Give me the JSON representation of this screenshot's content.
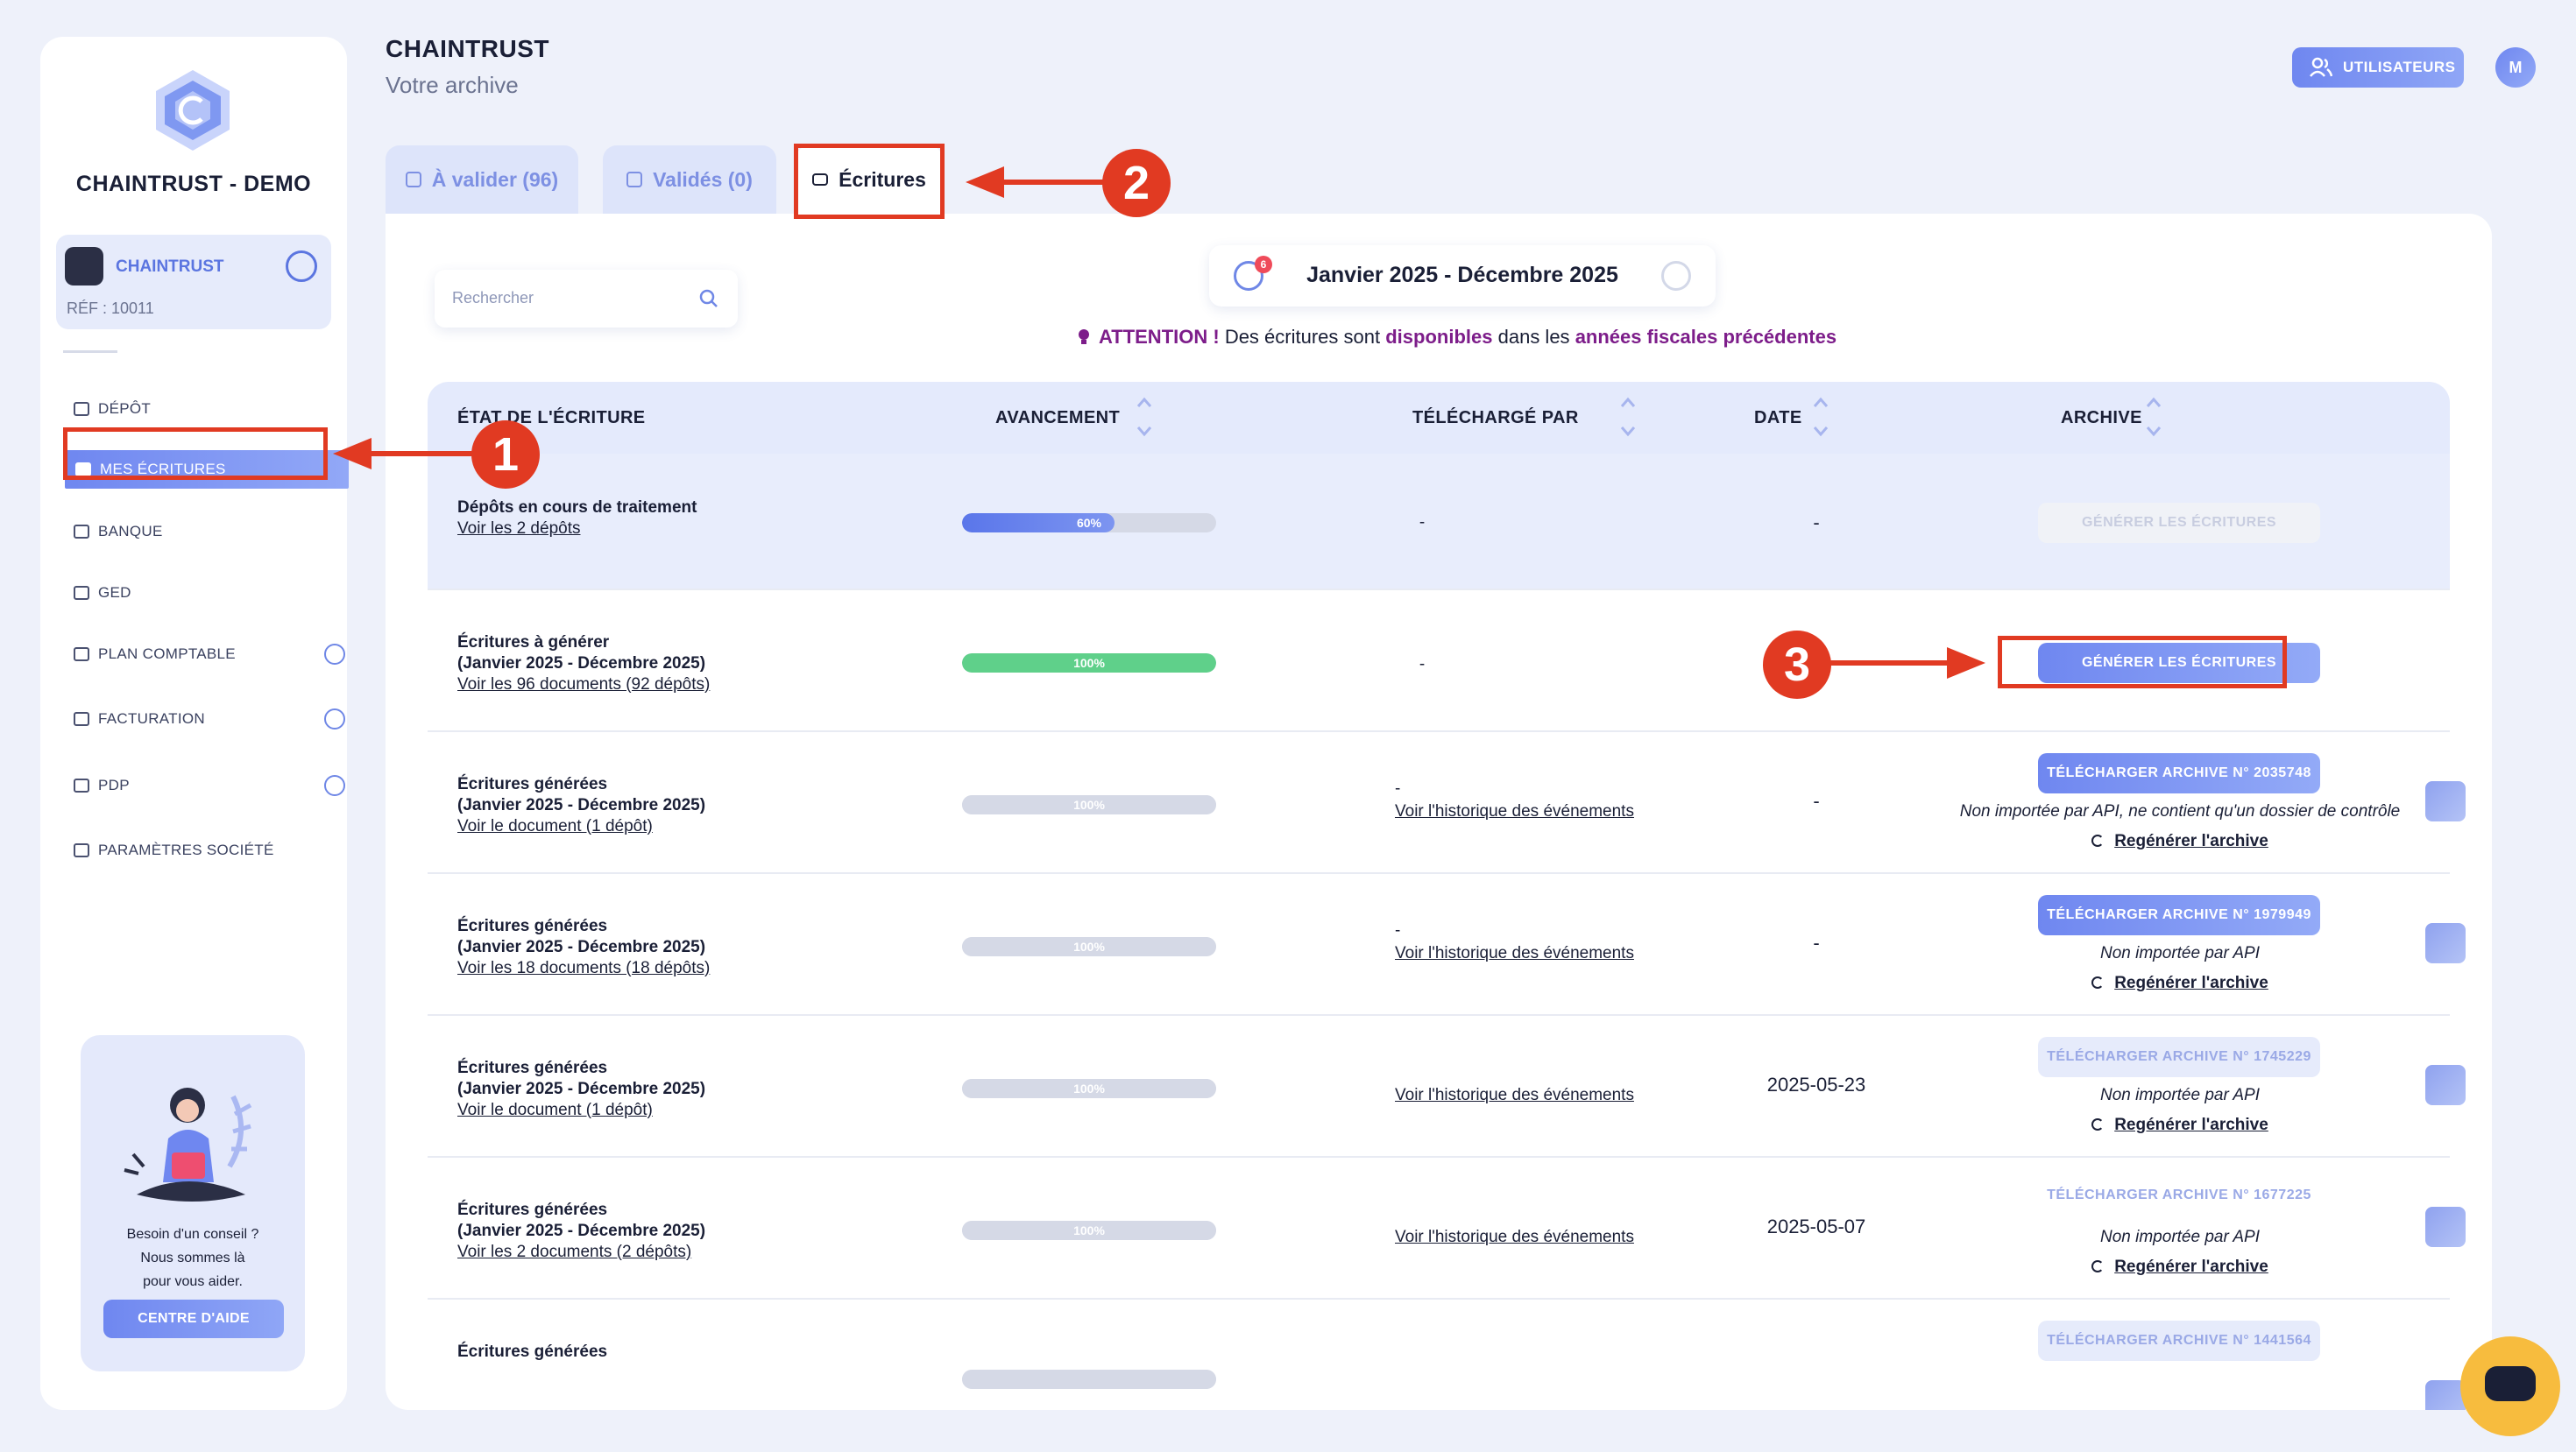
{
  "sidebar": {
    "brand": "CHAINTRUST - DEMO",
    "account": {
      "name": "CHAINTRUST",
      "ref": "RÉF : 10011"
    },
    "nav": [
      {
        "label": "DÉPÔT",
        "icon": "deposit-icon"
      },
      {
        "label": "MES ÉCRITURES",
        "icon": "entries-icon",
        "active": true
      },
      {
        "label": "BANQUE",
        "icon": "bank-icon"
      },
      {
        "label": "GED",
        "icon": "document-icon"
      },
      {
        "label": "PLAN COMPTABLE",
        "icon": "ledger-icon",
        "expandable": true
      },
      {
        "label": "FACTURATION",
        "icon": "invoice-icon",
        "expandable": true
      },
      {
        "label": "PDP",
        "icon": "card-icon",
        "expandable": true
      },
      {
        "label": "PARAMÈTRES SOCIÉTÉ",
        "icon": "settings-sliders-icon"
      }
    ],
    "help": {
      "line1": "Besoin d'un conseil ?",
      "line2": "Nous sommes là",
      "line3": "pour vous aider.",
      "button": "CENTRE D'AIDE"
    }
  },
  "header": {
    "title": "CHAINTRUST",
    "subtitle": "Votre archive",
    "users_button": "UTILISATEURS",
    "avatar": "M"
  },
  "tabs": [
    {
      "label": "À valider (96)",
      "active": false
    },
    {
      "label": "Validés (0)",
      "active": false
    },
    {
      "label": "Écritures",
      "active": true
    }
  ],
  "search": {
    "placeholder": "Rechercher"
  },
  "period": {
    "label": "Janvier 2025 - Décembre 2025",
    "badge": "6"
  },
  "attention": {
    "prefix": "ATTENTION !",
    "t1": "Des écritures sont",
    "b1": "disponibles",
    "t2": "dans les",
    "b2": "années fiscales précédentes"
  },
  "table": {
    "headers": [
      "ÉTAT DE L'ÉCRITURE",
      "AVANCEMENT",
      "TÉLÉCHARGÉ PAR",
      "DATE",
      "ARCHIVE"
    ],
    "rows": [
      {
        "title": "Dépôts en cours de traitement",
        "subtitle": "",
        "link": "Voir les 2 dépôts",
        "progress": 60,
        "progress_label": "60%",
        "uploaded_dash": "-",
        "uploaded_link": "",
        "date": "-",
        "archive_button": "GÉNÉRER LES ÉCRITURES",
        "archive_note": "",
        "regen": ""
      },
      {
        "title": "Écritures à générer",
        "subtitle": "(Janvier 2025 - Décembre 2025)",
        "link": "Voir les 96 documents (92 dépôts)",
        "progress": 100,
        "progress_label": "100%",
        "uploaded_dash": "-",
        "uploaded_link": "",
        "date": "",
        "archive_button": "GÉNÉRER LES ÉCRITURES",
        "archive_note": "",
        "regen": ""
      },
      {
        "title": "Écritures générées",
        "subtitle": "(Janvier 2025 - Décembre 2025)",
        "link": "Voir le document (1 dépôt)",
        "progress": 100,
        "progress_label": "100%",
        "uploaded_dash": "-",
        "uploaded_link": "Voir l'historique des événements",
        "date": "-",
        "archive_button": "TÉLÉCHARGER ARCHIVE N° 2035748",
        "archive_note": "Non importée par API, ne contient qu'un dossier de contrôle",
        "regen": "Regénérer l'archive"
      },
      {
        "title": "Écritures générées",
        "subtitle": "(Janvier 2025 - Décembre 2025)",
        "link": "Voir les 18 documents (18 dépôts)",
        "progress": 100,
        "progress_label": "100%",
        "uploaded_dash": "-",
        "uploaded_link": "Voir l'historique des événements",
        "date": "-",
        "archive_button": "TÉLÉCHARGER ARCHIVE N° 1979949",
        "archive_note": "Non importée par API",
        "regen": "Regénérer l'archive"
      },
      {
        "title": "Écritures générées",
        "subtitle": "(Janvier 2025 - Décembre 2025)",
        "link": "Voir le document (1 dépôt)",
        "progress": 100,
        "progress_label": "100%",
        "uploaded_dash": "",
        "uploaded_link": "Voir l'historique des événements",
        "date": "2025-05-23",
        "archive_button": "TÉLÉCHARGER ARCHIVE N° 1745229",
        "archive_note": "Non importée par API",
        "regen": "Regénérer l'archive"
      },
      {
        "title": "Écritures générées",
        "subtitle": "(Janvier 2025 - Décembre 2025)",
        "link": "Voir les 2 documents (2 dépôts)",
        "progress": 100,
        "progress_label": "100%",
        "uploaded_dash": "",
        "uploaded_link": "Voir l'historique des événements",
        "date": "2025-05-07",
        "archive_button": "TÉLÉCHARGER ARCHIVE N° 1677225",
        "archive_note": "Non importée par API",
        "regen": "Regénérer l'archive"
      },
      {
        "title": "Écritures générées",
        "subtitle": "",
        "link": "",
        "progress": 100,
        "progress_label": "",
        "uploaded_dash": "",
        "uploaded_link": "",
        "date": "",
        "archive_button": "TÉLÉCHARGER ARCHIVE N° 1441564",
        "archive_note": "",
        "regen": ""
      }
    ]
  },
  "annotations": [
    "1",
    "2",
    "3"
  ],
  "colors": {
    "accent": "#6f87f0",
    "annotation_red": "#e13a22",
    "progress_blue": "#6a84ee",
    "progress_green": "#5fd08a",
    "attention_purple": "#7d1d8a",
    "chat_yellow": "#f7bc3e"
  }
}
